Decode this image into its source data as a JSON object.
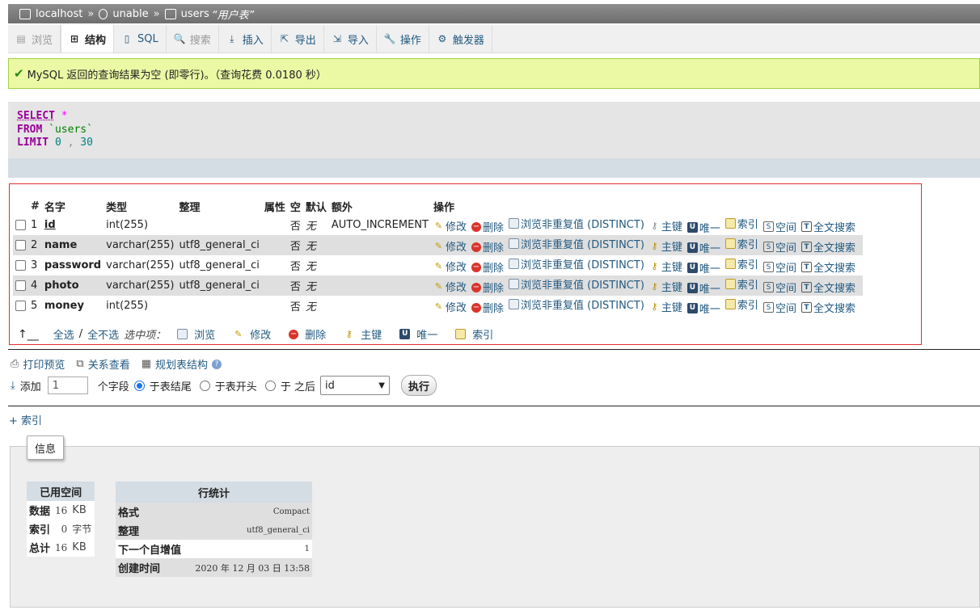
{
  "breadcrumb": {
    "server": "localhost",
    "database": "unable",
    "table": "users",
    "table_comment": "“用户表”",
    "separator": "»"
  },
  "tabs": [
    {
      "label": "浏览",
      "icon": "table-icon",
      "glyph": "▤",
      "state": "disabled"
    },
    {
      "label": "结构",
      "icon": "structure-icon",
      "glyph": "⊞",
      "state": "active"
    },
    {
      "label": "SQL",
      "icon": "sql-icon",
      "glyph": "▯",
      "state": "normal"
    },
    {
      "label": "搜索",
      "icon": "search-icon",
      "glyph": "🔍",
      "state": "disabled"
    },
    {
      "label": "插入",
      "icon": "insert-icon",
      "glyph": "⤓",
      "state": "normal"
    },
    {
      "label": "导出",
      "icon": "export-icon",
      "glyph": "⇱",
      "state": "normal"
    },
    {
      "label": "导入",
      "icon": "import-icon",
      "glyph": "⇲",
      "state": "normal"
    },
    {
      "label": "操作",
      "icon": "wrench-icon",
      "glyph": "🔧",
      "state": "normal"
    },
    {
      "label": "触发器",
      "icon": "trigger-icon",
      "glyph": "⚙",
      "state": "normal"
    }
  ],
  "message": "MySQL 返回的查询结果为空 (即零行)。（查询花费 0.0180 秒）",
  "sql": {
    "select_kw": "SELECT",
    "star": "*",
    "from_kw": "FROM",
    "table": "`users`",
    "limit_kw": "LIMIT",
    "offset": "0",
    "comma": ",",
    "count": "30"
  },
  "structure": {
    "headers": [
      "#",
      "名字",
      "类型",
      "整理",
      "属性",
      "空",
      "默认",
      "额外",
      "操作"
    ],
    "rows": [
      {
        "num": "1",
        "name": "id",
        "type": "int(255)",
        "collation": "",
        "attributes": "",
        "null": "否",
        "default": "无",
        "extra": "AUTO_INCREMENT"
      },
      {
        "num": "2",
        "name": "name",
        "type": "varchar(255)",
        "collation": "utf8_general_ci",
        "attributes": "",
        "null": "否",
        "default": "无",
        "extra": ""
      },
      {
        "num": "3",
        "name": "password",
        "type": "varchar(255)",
        "collation": "utf8_general_ci",
        "attributes": "",
        "null": "否",
        "default": "无",
        "extra": ""
      },
      {
        "num": "4",
        "name": "photo",
        "type": "varchar(255)",
        "collation": "utf8_general_ci",
        "attributes": "",
        "null": "否",
        "default": "无",
        "extra": ""
      },
      {
        "num": "5",
        "name": "money",
        "type": "int(255)",
        "collation": "",
        "attributes": "",
        "null": "否",
        "default": "无",
        "extra": ""
      }
    ],
    "actions": {
      "edit": "修改",
      "drop": "删除",
      "browse_distinct": "浏览非重复值 (DISTINCT)",
      "primary": "主键",
      "unique": "唯一",
      "index": "索引",
      "spatial": "空间",
      "fulltext": "全文搜索"
    },
    "with_selected": {
      "check_all": "全选",
      "slash": "/",
      "uncheck_all": "全不选",
      "label": "选中项：",
      "browse": "浏览",
      "edit": "修改",
      "drop": "删除",
      "primary": "主键",
      "unique": "唯一",
      "index": "索引"
    }
  },
  "links": {
    "print": "打印预览",
    "relation": "关系查看",
    "propose": "规划表结构"
  },
  "add_column": {
    "label": "添加",
    "count": "1",
    "unit": "个字段",
    "at_end": "于表结尾",
    "at_begin": "于表开头",
    "after": "于 之后",
    "after_column": "id",
    "go": "执行"
  },
  "add_index": "+ 索引",
  "info": {
    "legend": "信息",
    "space": {
      "title": "已用空间",
      "rows": [
        {
          "key": "数据",
          "value": "16",
          "unit": "KB"
        },
        {
          "key": "索引",
          "value": "0",
          "unit": "字节"
        },
        {
          "key": "总计",
          "value": "16",
          "unit": "KB"
        }
      ]
    },
    "row_stats": {
      "title": "行统计",
      "rows": [
        {
          "key": "格式",
          "value": "Compact"
        },
        {
          "key": "整理",
          "value": "utf8_general_ci"
        },
        {
          "key": "下一个自增值",
          "value": "1"
        },
        {
          "key": "创建时间",
          "value": "2020 年 12 月 03 日 13:58"
        }
      ]
    }
  },
  "colors": {
    "link": "#235a81",
    "success_bg": "#ebf8a4",
    "sql_keyword": "#990099",
    "highlight_border": "#e03030"
  }
}
